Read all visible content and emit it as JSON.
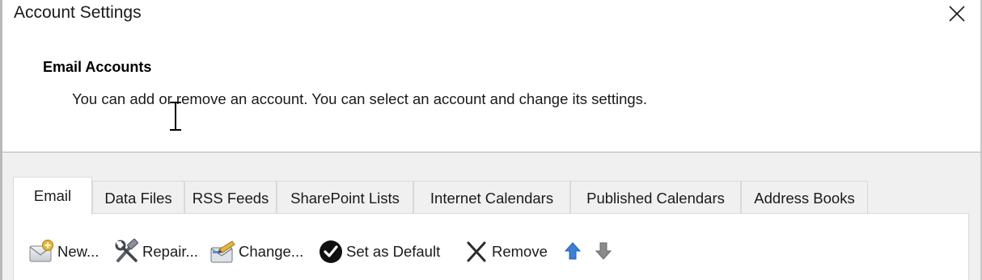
{
  "window": {
    "title": "Account Settings",
    "close_icon": "close-icon"
  },
  "header": {
    "heading": "Email Accounts",
    "description": "You can add or remove an account. You can select an account and change its settings."
  },
  "tabs": [
    {
      "label": "Email",
      "selected": true
    },
    {
      "label": "Data Files",
      "selected": false
    },
    {
      "label": "RSS Feeds",
      "selected": false
    },
    {
      "label": "SharePoint Lists",
      "selected": false
    },
    {
      "label": "Internet Calendars",
      "selected": false
    },
    {
      "label": "Published Calendars",
      "selected": false
    },
    {
      "label": "Address Books",
      "selected": false
    }
  ],
  "toolbar": {
    "new": {
      "label": "New...",
      "icon": "new-account-icon"
    },
    "repair": {
      "label": "Repair...",
      "icon": "repair-tools-icon"
    },
    "change": {
      "label": "Change...",
      "icon": "change-account-icon"
    },
    "set_default": {
      "label": "Set as Default",
      "icon": "checkmark-circle-icon"
    },
    "remove": {
      "label": "Remove",
      "icon": "remove-x-icon"
    },
    "move_up": {
      "icon": "arrow-up-icon",
      "color": "#3c7fd9"
    },
    "move_down": {
      "icon": "arrow-down-icon",
      "color": "#8a8a8a"
    }
  },
  "colors": {
    "dialog_bg": "#ffffff",
    "lower_bg": "#f0f0f0",
    "tab_border": "#d9d9d9",
    "divider": "#b3b3b3"
  }
}
